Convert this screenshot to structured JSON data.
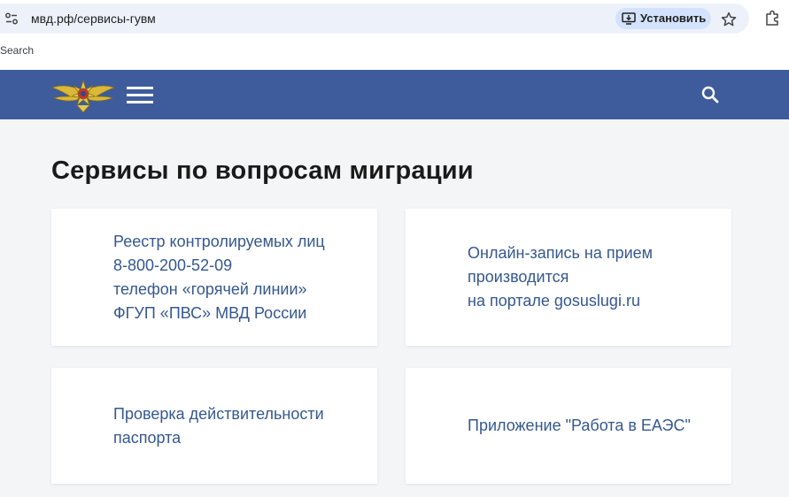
{
  "browser": {
    "url": "мвд.рф/сервисы-гувм",
    "install_label": "Установить",
    "search_hint": "Search"
  },
  "header": {
    "background_color": "#3e5c9c",
    "logo_icon": "police-emblem-icon",
    "menu_icon": "hamburger-menu-icon",
    "search_icon": "search-icon"
  },
  "main": {
    "title": "Сервисы по вопросам миграции",
    "link_color": "#35588f",
    "cards": [
      {
        "lines": [
          "Реестр контролируемых лиц",
          "8-800-200-52-09",
          "телефон «горячей линии»",
          "ФГУП «ПВС» МВД России"
        ]
      },
      {
        "lines": [
          "Онлайн-запись на прием",
          "производится",
          "на портале gosuslugi.ru"
        ]
      },
      {
        "lines": [
          "Проверка действительности",
          "паспорта"
        ]
      },
      {
        "lines": [
          "Приложение \"Работа в ЕАЭС\""
        ]
      }
    ]
  }
}
